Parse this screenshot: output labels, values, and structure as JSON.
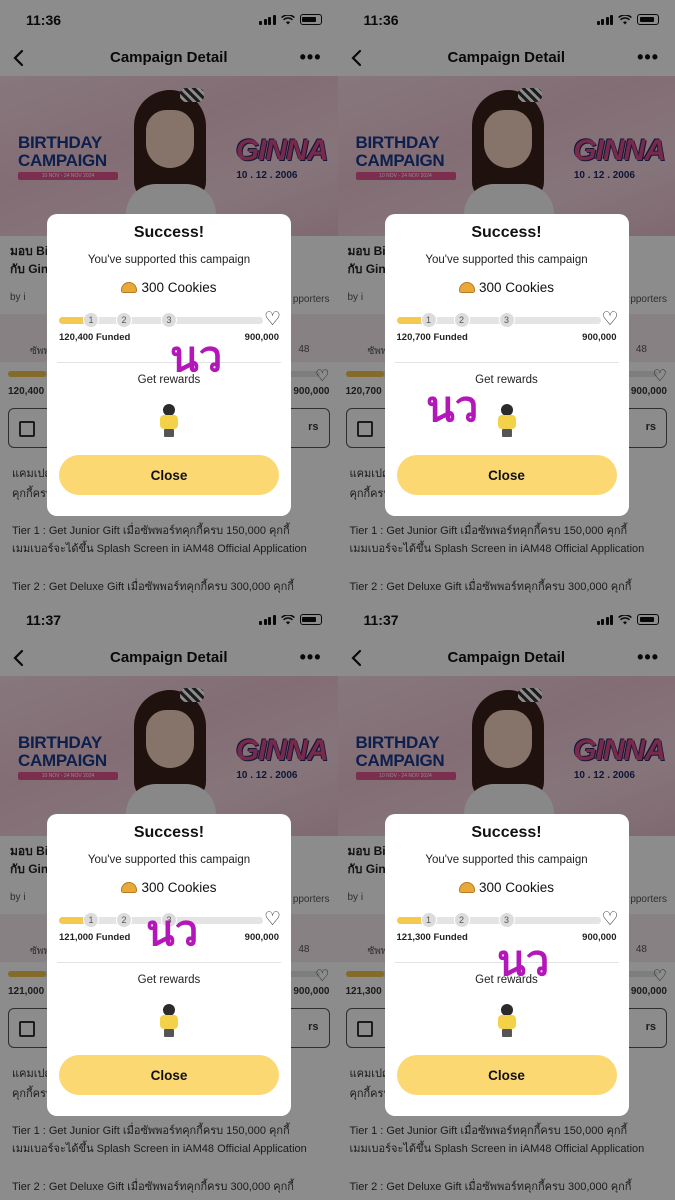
{
  "panels": [
    {
      "time": "11:36",
      "funded": "120,400 Funded",
      "progress_fraction": 0.134
    },
    {
      "time": "11:36",
      "funded": "120,700 Funded",
      "progress_fraction": 0.134
    },
    {
      "time": "11:37",
      "funded": "121,000 Funded",
      "progress_fraction": 0.134
    },
    {
      "time": "11:37",
      "funded": "121,300 Funded",
      "progress_fraction": 0.135
    }
  ],
  "nav": {
    "title": "Campaign Detail",
    "back_icon": "chevron-left-icon",
    "more_icon": "more-dots-icon"
  },
  "banner": {
    "line1": "BIRTHDAY",
    "line2": "CAMPAIGN",
    "date_strip": "10 NOV - 24 NOV 2024",
    "name": "GINNA",
    "birthdate": "10 . 12 . 2006"
  },
  "background_page": {
    "title_line1": "มอบ Bi",
    "title_line2": "กับ Gin",
    "by": "by i",
    "supporters": "pporters",
    "pink_text": "ซัพพ",
    "pink_48": "48",
    "button_text": "rs",
    "description_line1": "แคมเปญ                              ซัพพอร์ท",
    "description_line2": "คุกกี้ครบ",
    "tier1": "Tier 1 : Get Junior Gift เมื่อซัพพอร์ทคุกกี้ครบ 150,000 คุกกี้ เมมเบอร์จะได้ขึ้น Splash Screen in iAM48 Official Application",
    "tier2": "Tier 2 : Get Deluxe Gift เมื่อซัพพอร์ทคุกกี้ครบ 300,000 คุกกี้"
  },
  "modal": {
    "title": "Success!",
    "subtitle": "You've supported this campaign",
    "cookies": "300 Cookies",
    "cookie_icon": "cookie-icon",
    "tiers": [
      "1",
      "2",
      "3"
    ],
    "heart_icon": "heart-outline-icon",
    "goal": "900,000",
    "rewards_label": "Get rewards",
    "reward_icon": "mascot-figure-icon",
    "close_label": "Close"
  },
  "scribble_text": "นว",
  "colors": {
    "accent_yellow": "#fcd873",
    "progress_fill": "#f5c84e",
    "scribble": "#b417b9",
    "banner_pink": "#eec7d4"
  }
}
